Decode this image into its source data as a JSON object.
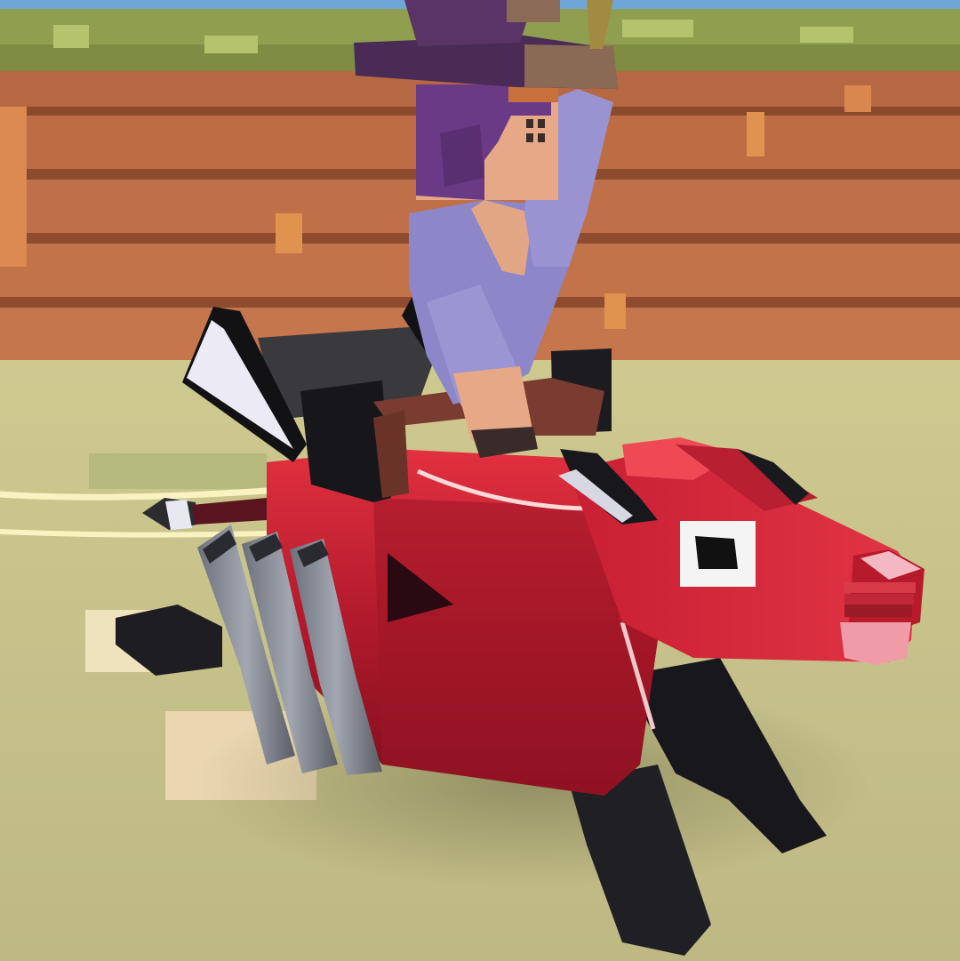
{
  "scene": {
    "type": "3d-voxel-game-render",
    "subject": "rider-on-mount",
    "hud": null
  },
  "palette": {
    "sky": "#6fa6d8",
    "grass_top": "#9aa85c",
    "cliff_dark": "#a45a38",
    "cliff_mid": "#bf6d45",
    "cliff_light": "#d3865a",
    "ground_light": "#d4cf9c",
    "ground_dark": "#b3ad7a",
    "mount_red": "#d8283c",
    "mount_red_light": "#ef4956",
    "mount_red_dark": "#7c1020",
    "leg_black": "#1e1e22",
    "pipe_gray": "#8c909c",
    "rider_shirt": "#8f87c9",
    "rider_hair": "#6a3a86",
    "rider_skin": "#e6a886",
    "hat_purple": "#4a2b56",
    "snout_pink": "#f2a7b3"
  }
}
